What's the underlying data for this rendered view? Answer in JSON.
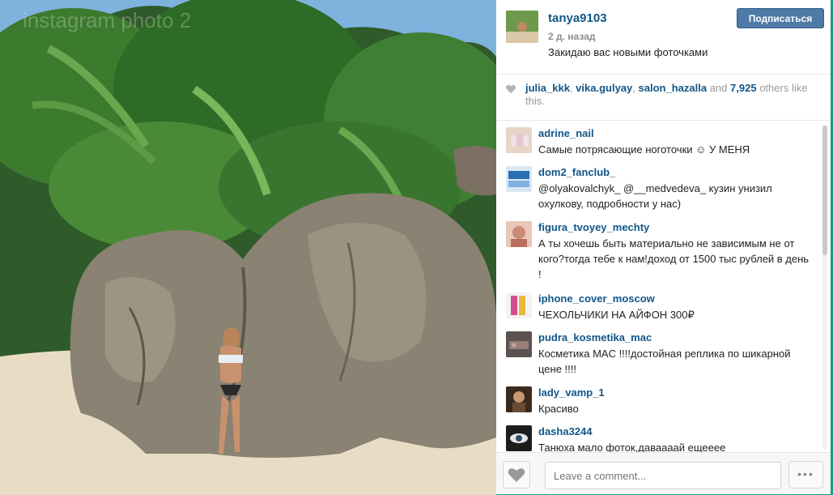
{
  "post": {
    "owner": "tanya9103",
    "time": "2 д. назад",
    "caption": "Закидаю вас новыми фоточками",
    "follow_label": "Подписаться",
    "watermark": "instagram photo 2"
  },
  "likes": {
    "users": [
      "julia_kkk",
      "vika.gulyay",
      "salon_hazalla"
    ],
    "and": "and",
    "count": "7,925",
    "suffix": "others like this."
  },
  "comments": [
    {
      "user": "adrine_nail",
      "text": "Самые потрясающие ноготочки ☺ У МЕНЯ"
    },
    {
      "user": "dom2_fanclub_",
      "text": "@olyakovalchyk_ @__medvedeva_ кузин унизил охулкову, подробности у нас)"
    },
    {
      "user": "figura_tvoyey_mechty",
      "text": "А ты хочешь быть материально не зависимым не от кого?тогда тебе к нам!доход от 1500 тыс рублей в день !"
    },
    {
      "user": "iphone_cover_moscow",
      "text": "ЧЕХОЛЬЧИКИ НА АЙФОН 300₽"
    },
    {
      "user": "pudra_kosmetika_mac",
      "text": "Косметика MAC !!!!достойная реплика по шикарной цене !!!!"
    },
    {
      "user": "lady_vamp_1",
      "text": "Красиво"
    },
    {
      "user": "dasha3244",
      "text": "Танюха мало фоток,даваааай ещееее"
    }
  ],
  "footer": {
    "comment_placeholder": "Leave a comment...",
    "more_label": "•••"
  },
  "colors": {
    "username": "#125688",
    "follow_button": "#4d7aa6",
    "frame": "#1a9a8a"
  }
}
